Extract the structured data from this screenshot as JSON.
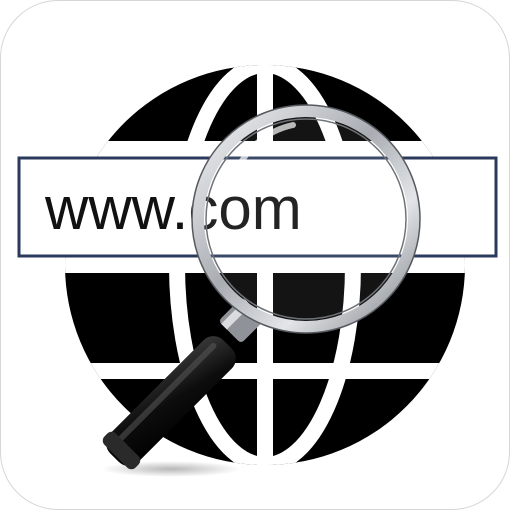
{
  "icon": {
    "url_text": "www.com",
    "name": "web-search",
    "colors": {
      "globe": "#000000",
      "address_bar_border": "#2b3a5c",
      "lens_rim": "#bfc3c8",
      "handle": "#101010",
      "background": "#ffffff"
    }
  }
}
